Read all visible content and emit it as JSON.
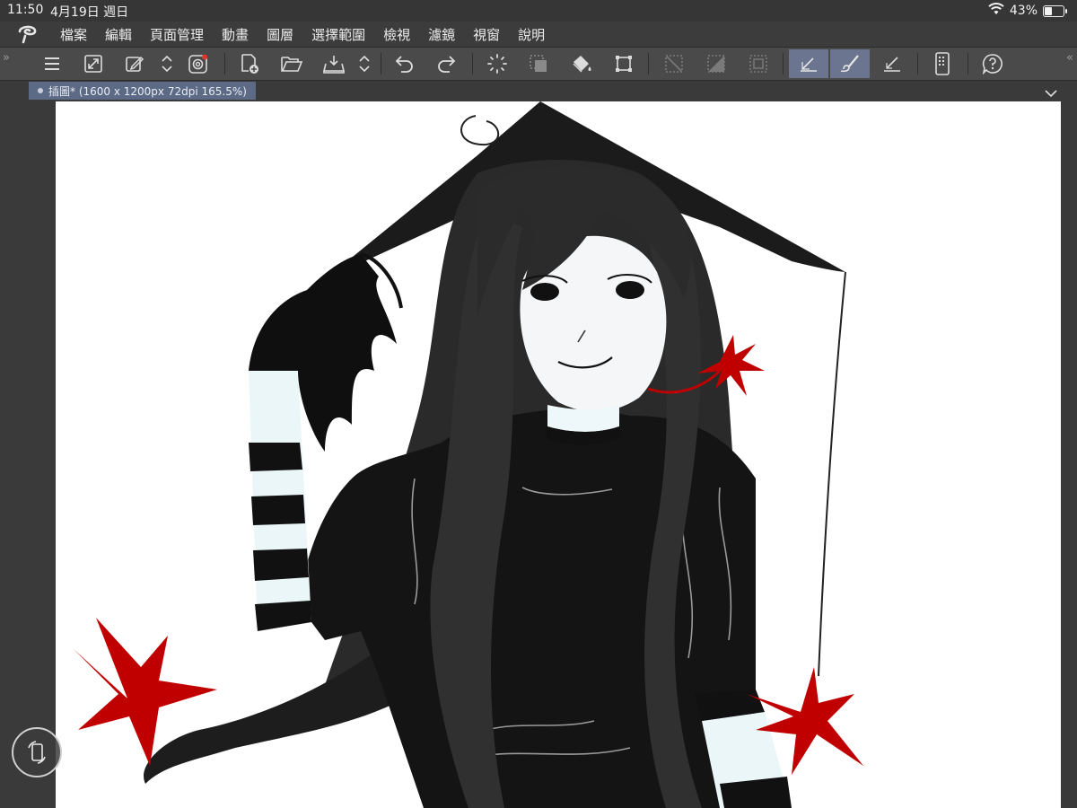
{
  "status_bar": {
    "time": "11:50",
    "date": "4月19日 週日",
    "battery": "43%",
    "battery_level": 0.43
  },
  "menu": {
    "items": [
      "檔案",
      "編輯",
      "頁面管理",
      "動畫",
      "圖層",
      "選擇範圍",
      "檢視",
      "濾鏡",
      "視窗",
      "說明"
    ]
  },
  "toolbar": {
    "buttons": [
      "menu-icon",
      "resize-icon",
      "edit-icon",
      "up-down-arrows-icon",
      "record-icon",
      "new-page-icon",
      "open-folder-icon",
      "export-icon",
      "up-down-arrows-icon",
      "undo-icon",
      "redo-icon",
      "loading-icon",
      "selection-icon",
      "fill-icon",
      "transform-icon",
      "deselect-icon",
      "gradient-icon",
      "select-all-icon",
      "ruler-icon",
      "brush-icon",
      "ruler-snap-icon",
      "device-icon",
      "help-icon"
    ],
    "active": [
      "ruler-icon",
      "brush-icon"
    ]
  },
  "document": {
    "tab_label": "插圖* (1600 x 1200px 72dpi 165.5%)"
  },
  "colors": {
    "accent": "#6b7590",
    "tab": "#5c6a85",
    "canvas_bg": "#ffffff",
    "ink": "#111111",
    "red": "#c00000"
  }
}
